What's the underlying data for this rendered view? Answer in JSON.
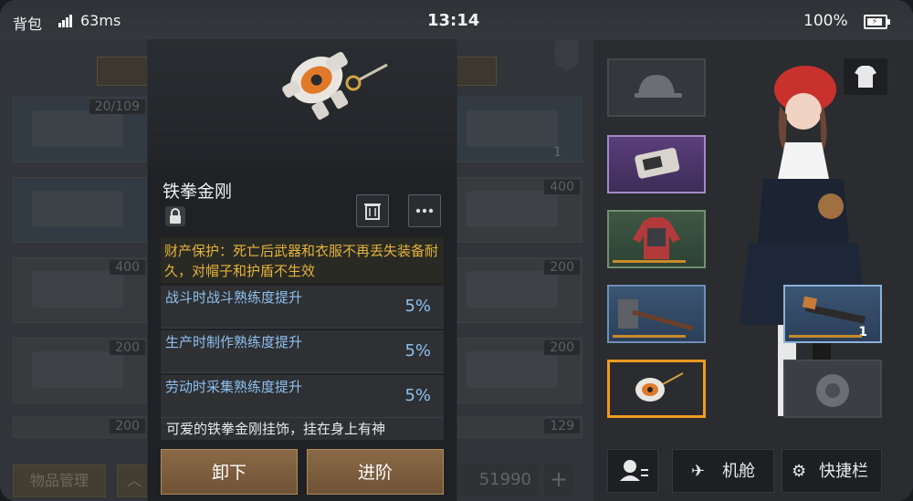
{
  "status_bar": {
    "title": "背包",
    "ping": "63ms",
    "time": "13:14",
    "battery": "100%"
  },
  "inventory": {
    "slot_counts": [
      "20/109",
      "400",
      "400",
      "200",
      "200",
      "200",
      "200",
      "129"
    ],
    "weapon_count": "1",
    "manage_label": "物品管理",
    "coins": "51990"
  },
  "item": {
    "name": "铁拳金刚",
    "property_protection": "财产保护：死亡后武器和衣服不再丢失装备耐久，对帽子和护盾不生效",
    "stats": [
      {
        "label": "战斗时战斗熟练度提升",
        "value": "5%"
      },
      {
        "label": "生产时制作熟练度提升",
        "value": "5%"
      },
      {
        "label": "劳动时采集熟练度提升",
        "value": "5%"
      }
    ],
    "description": "可爱的铁拳金刚挂饰，挂在身上有神",
    "actions": {
      "unequip": "卸下",
      "advance": "进阶"
    }
  },
  "equipment": {
    "weapon_count": "1",
    "buttons": {
      "cabin": "机舱",
      "shortcut": "快捷栏"
    }
  },
  "colors": {
    "accent_orange": "#f09a1f",
    "gold_text": "#e3b23a",
    "stat_blue": "#8fc0ee",
    "button_brown": "#8a6a47"
  }
}
